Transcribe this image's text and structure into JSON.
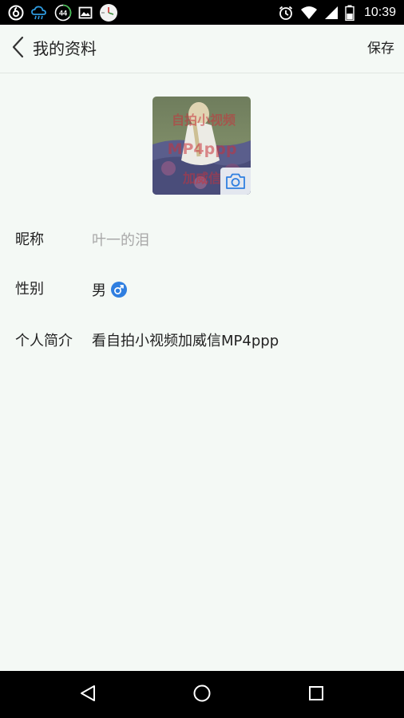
{
  "status_bar": {
    "time": "10:39",
    "left_icons": [
      "netease-music-icon",
      "weather-icon",
      "badge-44-icon",
      "image-icon",
      "clock-app-icon"
    ],
    "badge_text": "44",
    "right_icons": [
      "alarm-icon",
      "wifi-icon",
      "cell-signal-icon",
      "battery-icon"
    ]
  },
  "header": {
    "title": "我的资料",
    "save_label": "保存",
    "back_icon": "chevron-left-icon"
  },
  "avatar": {
    "watermark_lines": [
      "自拍小视频",
      "MP4ppp",
      "加威信"
    ],
    "camera_icon": "camera-icon"
  },
  "profile": {
    "nickname_label": "昵称",
    "nickname_placeholder": "叶一的泪",
    "gender_label": "性别",
    "gender_value": "男",
    "gender_symbol": "♂",
    "bio_label": "个人简介",
    "bio_value": "看自拍小视频加威信MP4ppp"
  },
  "colors": {
    "background": "#f4f9f5",
    "text": "#222222",
    "placeholder": "#a8a8a8",
    "accent_blue": "#2f7fe0",
    "watermark_red": "#c8323c"
  },
  "nav_bar": {
    "icons": [
      "back-triangle-icon",
      "home-circle-icon",
      "recents-square-icon"
    ]
  }
}
